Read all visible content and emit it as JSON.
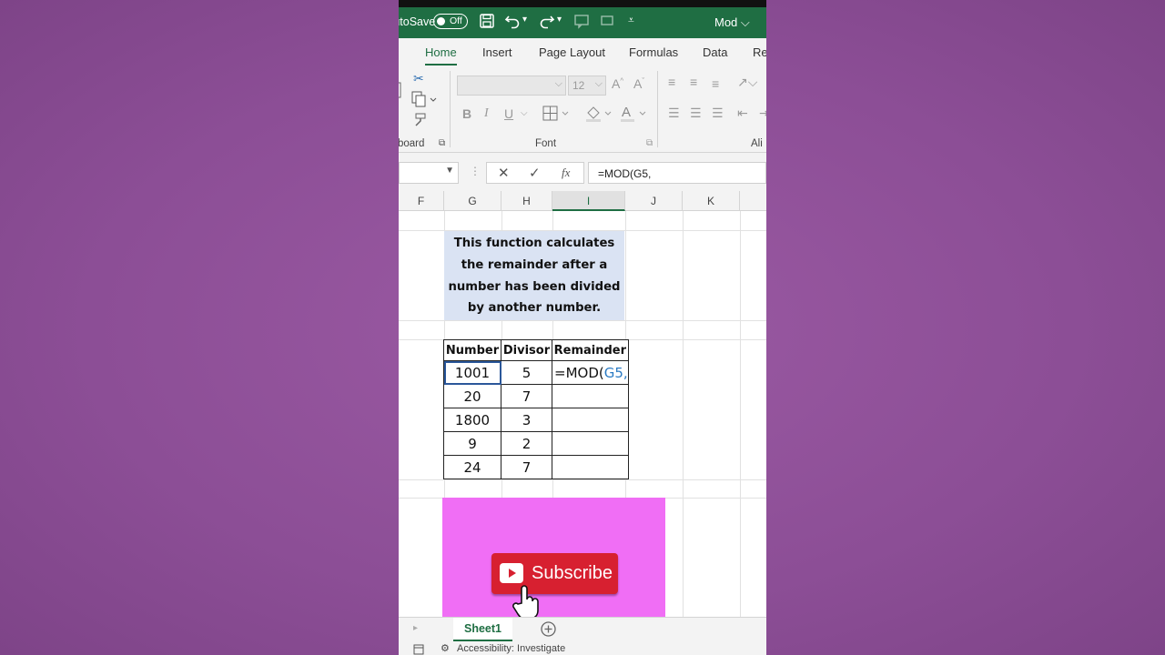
{
  "titlebar": {
    "autosave_label": "AutoSave",
    "autosave_state": "Off",
    "document_name": "Mod"
  },
  "tabs": [
    "Home",
    "Insert",
    "Page Layout",
    "Formulas",
    "Data",
    "Re"
  ],
  "active_tab": "Home",
  "ribbon": {
    "font_size": "12",
    "clipboard_label": "board",
    "font_label": "Font",
    "alignment_label": "Ali",
    "bold_label": "B",
    "italic_label": "I",
    "underline_label": "U"
  },
  "formula_bar": {
    "fx_label": "fx",
    "content": "=MOD(G5,"
  },
  "columns": [
    "F",
    "G",
    "H",
    "I",
    "J",
    "K"
  ],
  "selected_column": "I",
  "note": {
    "lines": [
      "This function calculates",
      "the remainder after a",
      "number has been divided",
      "by another number."
    ]
  },
  "table": {
    "headers": [
      "Number",
      "Divisor",
      "Remainder"
    ],
    "rows": [
      {
        "number": "1001",
        "divisor": "5"
      },
      {
        "number": "20",
        "divisor": "7"
      },
      {
        "number": "1800",
        "divisor": "3"
      },
      {
        "number": "9",
        "divisor": "2"
      },
      {
        "number": "24",
        "divisor": "7"
      }
    ],
    "editing_formula_prefix": "=MOD(",
    "editing_formula_ref": "G5",
    "editing_formula_suffix": ","
  },
  "promo": {
    "button_label": "Subscribe"
  },
  "sheetbar": {
    "sheet_name": "Sheet1"
  },
  "statusbar": {
    "accessibility": "Accessibility: Investigate"
  },
  "colors": {
    "excel_green": "#1f6e43",
    "note_bg": "#dae3f3",
    "promo_bg": "#f06ef5",
    "subscribe_red": "#d72030",
    "ref_blue": "#2b7bc4",
    "background_purple": "#8c4e96"
  }
}
